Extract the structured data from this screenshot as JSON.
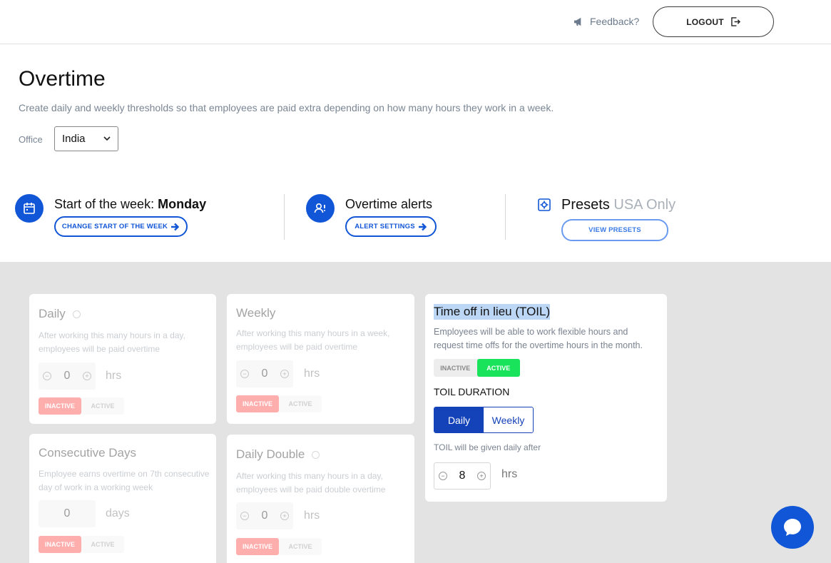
{
  "topbar": {
    "feedback_label": "Feedback?",
    "logout_label": "LOGOUT"
  },
  "header": {
    "title": "Overtime",
    "description": "Create daily and weekly thresholds so that employees are paid extra depending on how many hours they work in a week.",
    "office_label": "Office",
    "office_value": "India"
  },
  "settings": {
    "week_prefix": "Start of the week: ",
    "week_value": "Monday",
    "week_button": "CHANGE START OF THE WEEK",
    "alerts_title": "Overtime alerts",
    "alerts_button": "ALERT SETTINGS",
    "presets_title": "Presets",
    "presets_note": "USA Only",
    "presets_button": "VIEW PRESETS"
  },
  "cards": {
    "daily": {
      "title": "Daily",
      "desc": "After working this many hours in a day, employees will be paid overtime",
      "value": "0",
      "unit": "hrs",
      "inactive": "INACTIVE",
      "active": "ACTIVE"
    },
    "weekly": {
      "title": "Weekly",
      "desc": "After working this many hours in a week, employees will be paid overtime",
      "value": "0",
      "unit": "hrs",
      "inactive": "INACTIVE",
      "active": "ACTIVE"
    },
    "consecutive": {
      "title": "Consecutive Days",
      "desc": "Employee earns overtime on 7th consecutive day of work in a working week",
      "value": "0",
      "unit": "days",
      "inactive": "INACTIVE",
      "active": "ACTIVE"
    },
    "daily_double": {
      "title": "Daily Double",
      "desc": "After working this many hours in a day, employees will be paid double overtime",
      "value": "0",
      "unit": "hrs",
      "inactive": "INACTIVE",
      "active": "ACTIVE"
    },
    "toil": {
      "title": "Time off in lieu (TOIL)",
      "desc": "Employees will be able to work flexible hours and request time offs for the overtime hours in the month.",
      "inactive": "INACTIVE",
      "active": "ACTIVE",
      "duration_label": "TOIL DURATION",
      "duration_daily": "Daily",
      "duration_weekly": "Weekly",
      "note": "TOIL will be given daily after",
      "value": "8",
      "unit": "hrs"
    }
  },
  "colors": {
    "primary": "#1156d6",
    "segment": "#1442b8",
    "active_green": "#19e35a",
    "inactive_red": "#ff4d4d",
    "content_bg": "#e3e3e3"
  }
}
